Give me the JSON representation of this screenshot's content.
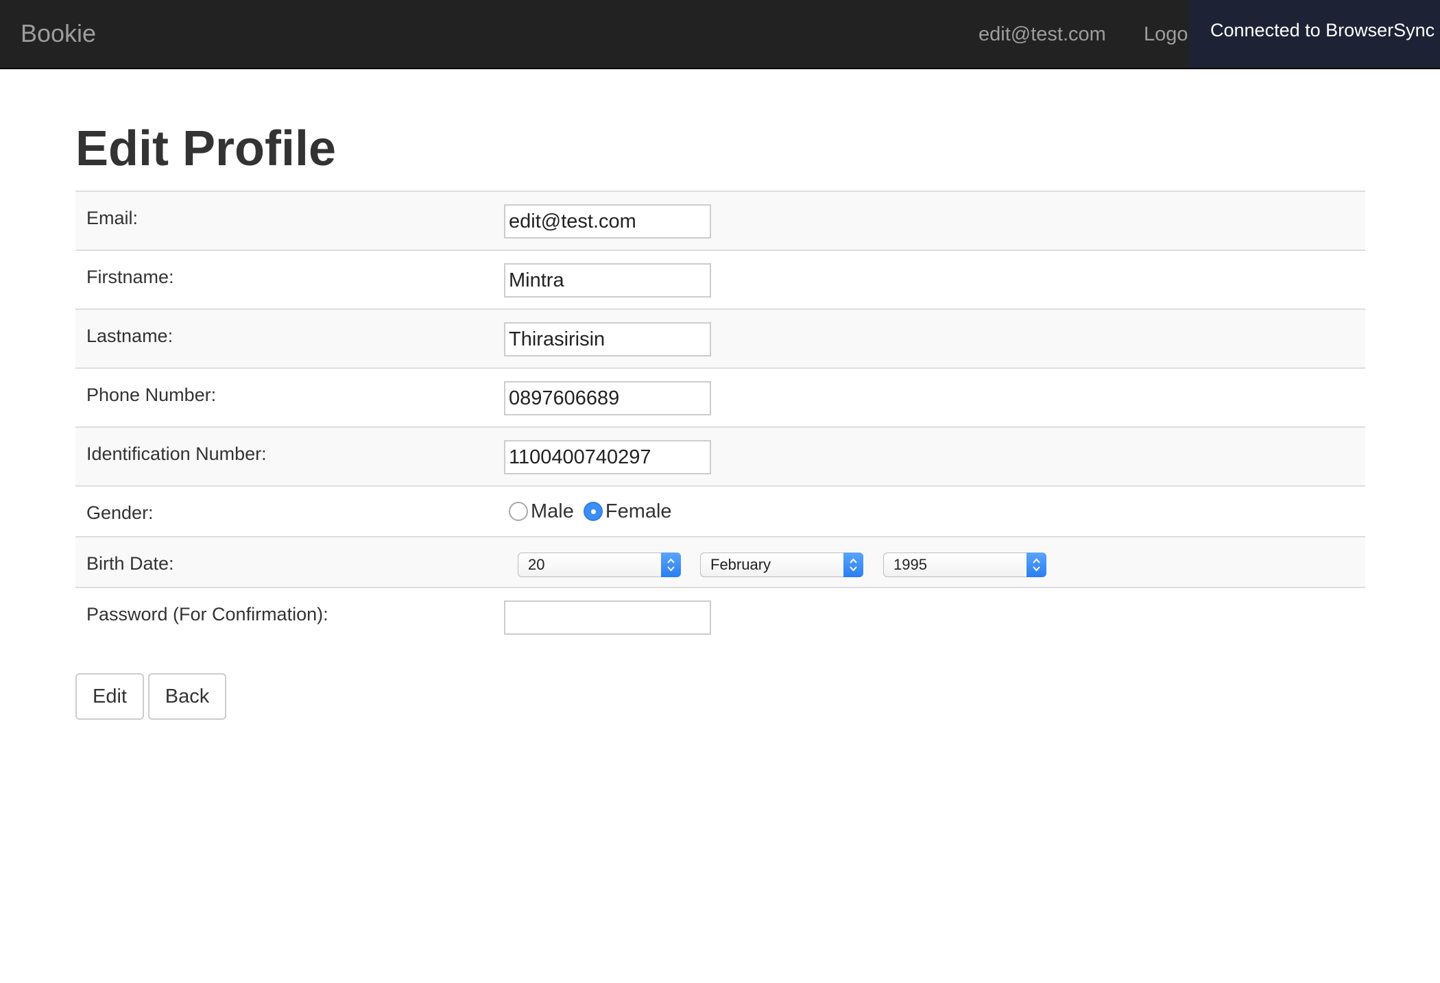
{
  "navbar": {
    "brand": "Bookie",
    "user_email": "edit@test.com",
    "logout_label": "Logo",
    "browsersync_notice": "Connected to BrowserSync"
  },
  "page": {
    "title": "Edit Profile"
  },
  "form": {
    "email": {
      "label": "Email:",
      "value": "edit@test.com"
    },
    "firstname": {
      "label": "Firstname:",
      "value": "Mintra"
    },
    "lastname": {
      "label": "Lastname:",
      "value": "Thirasirisin"
    },
    "phone": {
      "label": "Phone Number:",
      "value": "0897606689"
    },
    "identification": {
      "label": "Identification Number:",
      "value": "1100400740297"
    },
    "gender": {
      "label": "Gender:",
      "options": [
        "Male",
        "Female"
      ],
      "selected": "Female"
    },
    "birth_date": {
      "label": "Birth Date:",
      "day": "20",
      "month": "February",
      "year": "1995"
    },
    "password": {
      "label": "Password (For Confirmation):",
      "value": ""
    }
  },
  "actions": {
    "edit_label": "Edit",
    "back_label": "Back"
  },
  "colors": {
    "navbar_bg": "#222222",
    "navbar_text": "#9d9d9d",
    "browsersync_bg": "#1d2235",
    "radio_selected": "#3d8ef7",
    "select_caret": "#2b7ef0"
  }
}
